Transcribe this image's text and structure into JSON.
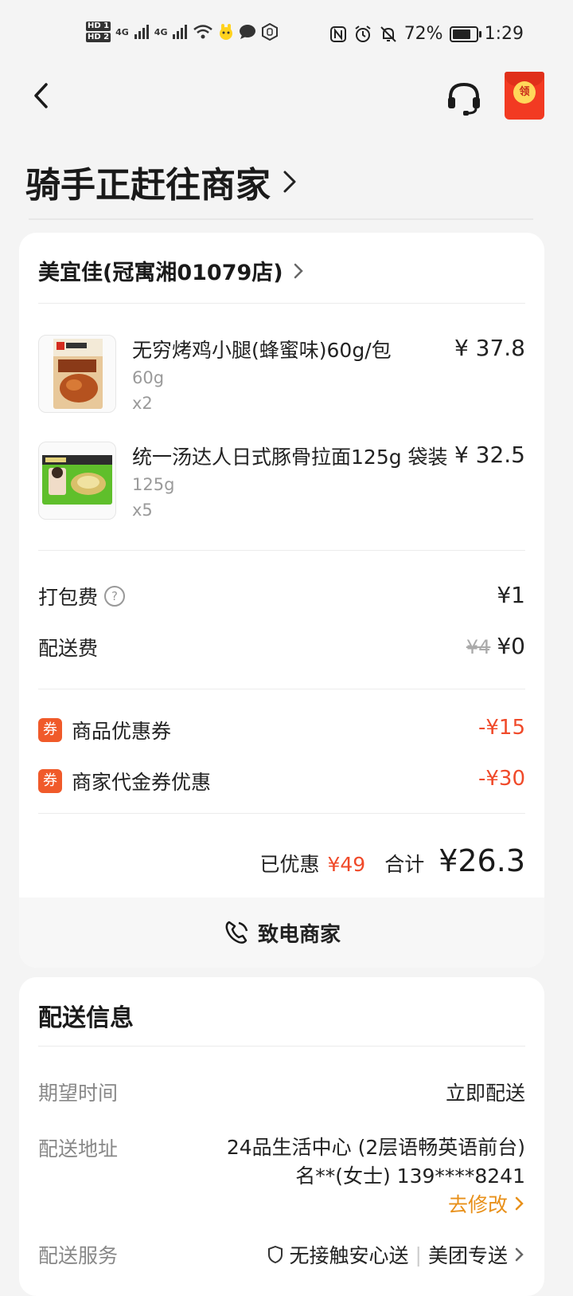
{
  "status_bar": {
    "hd1": "HD 1",
    "hd2": "HD 2",
    "net1": "4G",
    "net2": "4G",
    "battery": "72%",
    "time": "1:29"
  },
  "header": {
    "redpacket_label": "领"
  },
  "page_title": "骑手正赶往商家",
  "order": {
    "store_name": "美宜佳(冠寓湘01079店)",
    "items": [
      {
        "name": "无穷烤鸡小腿(蜂蜜味)60g/包",
        "price": "¥ 37.8",
        "spec": "60g",
        "qty": "x2"
      },
      {
        "name": "统一汤达人日式豚骨拉面125g 袋装",
        "price": "¥ 32.5",
        "spec": "125g",
        "qty": "x5"
      }
    ],
    "packing_fee": {
      "label": "打包费",
      "value": "¥1"
    },
    "delivery_fee": {
      "label": "配送费",
      "original": "¥4",
      "value": "¥0"
    },
    "coupons": [
      {
        "tag": "券",
        "label": "商品优惠券",
        "value": "-¥15"
      },
      {
        "tag": "券",
        "label": "商家代金券优惠",
        "value": "-¥30"
      }
    ],
    "saved_label": "已优惠",
    "saved_amount": "¥49",
    "total_label": "合计",
    "total_value": "¥26.3",
    "call_label": "致电商家"
  },
  "delivery": {
    "title": "配送信息",
    "time_label": "期望时间",
    "time_value": "立即配送",
    "address_label": "配送地址",
    "address_line1": "24品生活中心 (2层语畅英语前台)",
    "address_line2": "名**(女士) 139****8241",
    "edit_label": "去修改",
    "service_label": "配送服务",
    "service_value1": "无接触安心送",
    "service_value2": "美团专送"
  },
  "colors": {
    "accent_red": "#f04a2a",
    "edit_orange": "#e8901a",
    "redpacket": "#f23a22"
  }
}
